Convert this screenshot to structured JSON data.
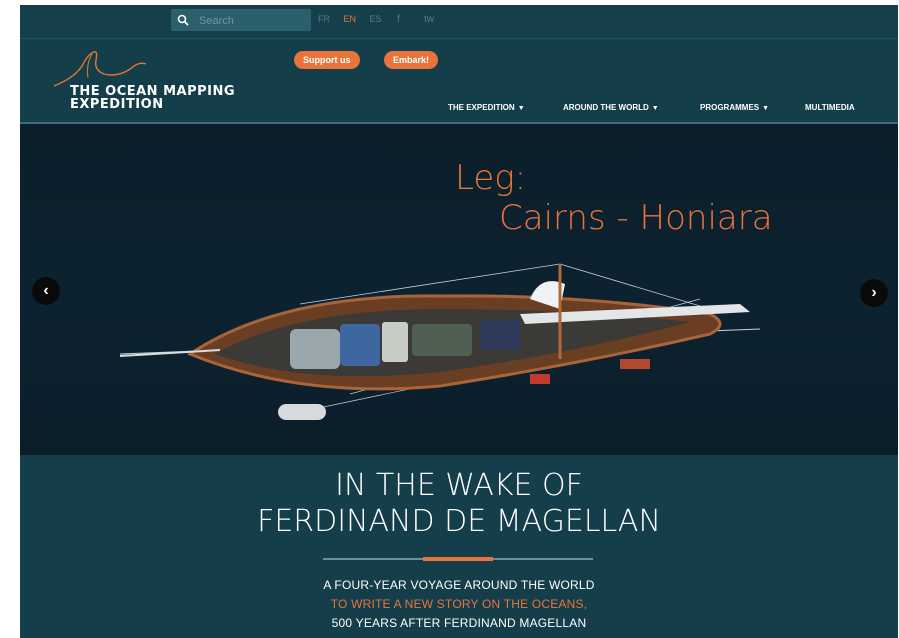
{
  "topbar": {
    "search_placeholder": "Search",
    "languages": [
      "FR",
      "EN",
      "ES"
    ],
    "active_language": "EN",
    "social": [
      "f",
      "tw"
    ]
  },
  "header": {
    "logo_line1": "THE OCEAN MAPPING",
    "logo_line2": "EXPEDITION",
    "support_label": "Support us",
    "embark_label": "Embark!",
    "nav": [
      {
        "label": "THE EXPEDITION",
        "has_dropdown": true
      },
      {
        "label": "AROUND THE WORLD",
        "has_dropdown": true
      },
      {
        "label": "PROGRAMMES",
        "has_dropdown": true
      },
      {
        "label": "MULTIMEDIA",
        "has_dropdown": false
      }
    ]
  },
  "hero": {
    "leg_line1": "Leg:",
    "leg_line2": "Cairns - Honiara",
    "prev_glyph": "‹",
    "next_glyph": "›"
  },
  "intro": {
    "headline_line1": "IN THE WAKE OF",
    "headline_line2": "FERDINAND DE MAGELLAN",
    "tagline_line1": "A FOUR-YEAR VOYAGE AROUND THE WORLD",
    "tagline_line2": "TO WRITE A NEW STORY ON THE OCEANS,",
    "tagline_line3": "500 YEARS AFTER FERDINAND MAGELLAN"
  },
  "colors": {
    "background": "#143e4a",
    "accent": "#e8743b",
    "hero_sea": "#0b1e2a"
  }
}
